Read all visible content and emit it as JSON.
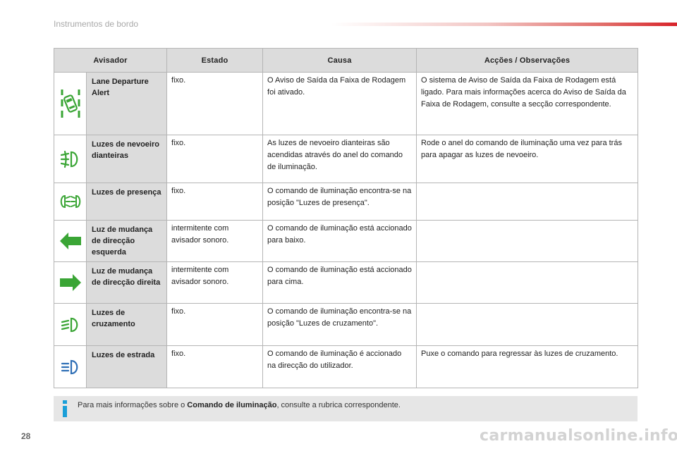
{
  "header": {
    "title": "Instrumentos de bordo"
  },
  "table": {
    "headers": [
      "Avisador",
      "Estado",
      "Causa",
      "Acções / Observações"
    ],
    "rows": [
      {
        "icon": "lane-departure-icon",
        "icon_color": "#3aa535",
        "name": "Lane Departure Alert",
        "estado": "fixo.",
        "causa": "O Aviso de Saída da Faixa de Rodagem foi ativado.",
        "accoes": "O sistema de Aviso de Saída da Faixa de Rodagem está ligado. Para mais informações acerca do Aviso de Saída da Faixa de Rodagem, consulte a secção correspondente."
      },
      {
        "icon": "front-fog-lamp-icon",
        "icon_color": "#3aa535",
        "name": "Luzes de nevoeiro dianteiras",
        "estado": "fixo.",
        "causa": "As luzes de nevoeiro dianteiras são acendidas através do anel do comando de iluminação.",
        "accoes": "Rode o anel do comando de iluminação uma vez para trás para apagar as luzes de nevoeiro."
      },
      {
        "icon": "side-lamps-icon",
        "icon_color": "#3aa535",
        "name": "Luzes de presença",
        "estado": "fixo.",
        "causa": "O comando de iluminação encontra-se na posição \"Luzes de presença\".",
        "accoes": ""
      },
      {
        "icon": "left-arrow-icon",
        "icon_color": "#3aa535",
        "name": "Luz de mudança de direcção esquerda",
        "estado": "intermitente com avisador sonoro.",
        "causa": "O comando de iluminação está accionado para baixo.",
        "accoes": ""
      },
      {
        "icon": "right-arrow-icon",
        "icon_color": "#3aa535",
        "name": "Luz de mudança de direcção direita",
        "estado": "intermitente com avisador sonoro.",
        "causa": "O comando de iluminação está accionado para cima.",
        "accoes": ""
      },
      {
        "icon": "dipped-beam-icon",
        "icon_color": "#3aa535",
        "name": "Luzes de cruzamento",
        "estado": "fixo.",
        "causa": "O comando de iluminação encontra-se na posição \"Luzes de cruzamento\".",
        "accoes": ""
      },
      {
        "icon": "main-beam-icon",
        "icon_color": "#2f6fb6",
        "name": "Luzes de estrada",
        "estado": "fixo.",
        "causa": "O comando de iluminação é accionado na direcção do utilizador.",
        "accoes": "Puxe o comando para regressar às luzes de cruzamento."
      }
    ]
  },
  "info": {
    "icon": "info-icon",
    "icon_color": "#1a9fd8",
    "prefix": "Para mais informações sobre o ",
    "bold": "Comando de iluminação",
    "suffix": ", consulte a rubrica correspondente."
  },
  "footer": {
    "page_number": "28",
    "watermark": "carmanualsonline.info"
  }
}
